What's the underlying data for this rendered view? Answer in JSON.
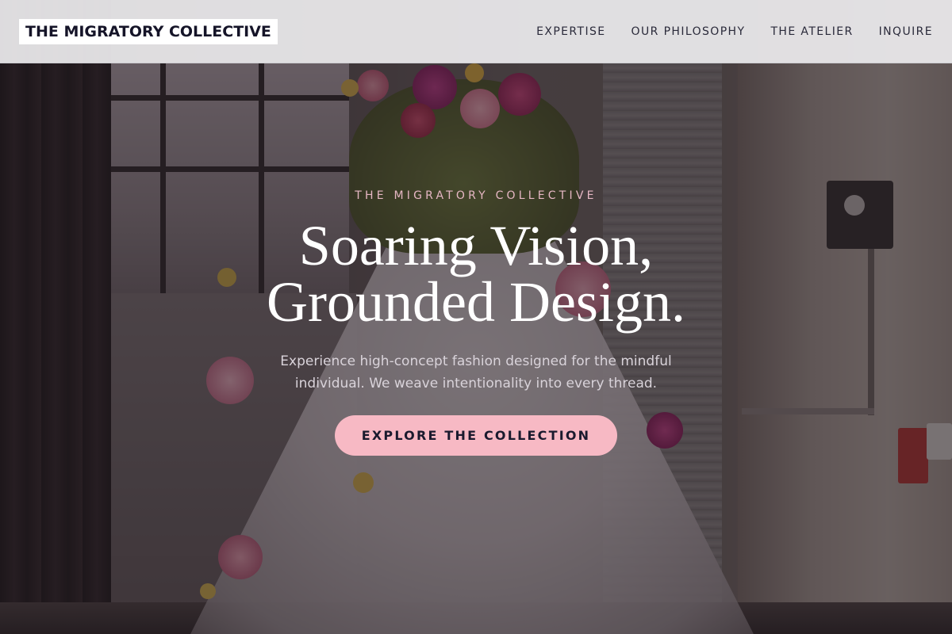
{
  "header": {
    "brand": "THE MIGRATORY COLLECTIVE",
    "nav": [
      {
        "label": "EXPERTISE"
      },
      {
        "label": "OUR PHILOSOPHY"
      },
      {
        "label": "THE ATELIER"
      },
      {
        "label": "INQUIRE"
      }
    ]
  },
  "hero": {
    "eyebrow": "THE MIGRATORY COLLECTIVE",
    "headline_line1": "Soaring Vision,",
    "headline_line2": "Grounded Design.",
    "subtitle": "Experience high-concept fashion designed for the mindful individual. We weave intentionality into every thread.",
    "cta_label": "EXPLORE THE COLLECTION"
  },
  "colors": {
    "accent_pink": "#f7b9c4",
    "eyebrow_pink": "#e6b7c4",
    "navy": "#151428",
    "header_bg": "#eeedef"
  }
}
